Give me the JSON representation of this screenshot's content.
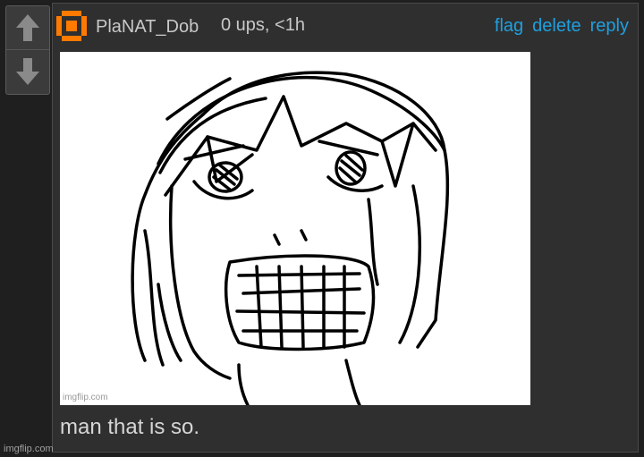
{
  "vote": {
    "up_icon": "arrow-up-icon",
    "down_icon": "arrow-down-icon"
  },
  "comment": {
    "user_icon": "user-avatar-icon",
    "username": "PlaNAT_Dob",
    "meta": "0 ups, <1h",
    "actions": {
      "flag": "flag",
      "delete": "delete",
      "reply": "reply"
    },
    "image_watermark": "imgflip.com",
    "text": "man that is so."
  },
  "colors": {
    "accent": "#1fa0e0",
    "avatar": "#ff7a00",
    "background": "#1f1f1f",
    "panel": "#2f2f2f"
  },
  "page_watermark": "imgflip.com"
}
